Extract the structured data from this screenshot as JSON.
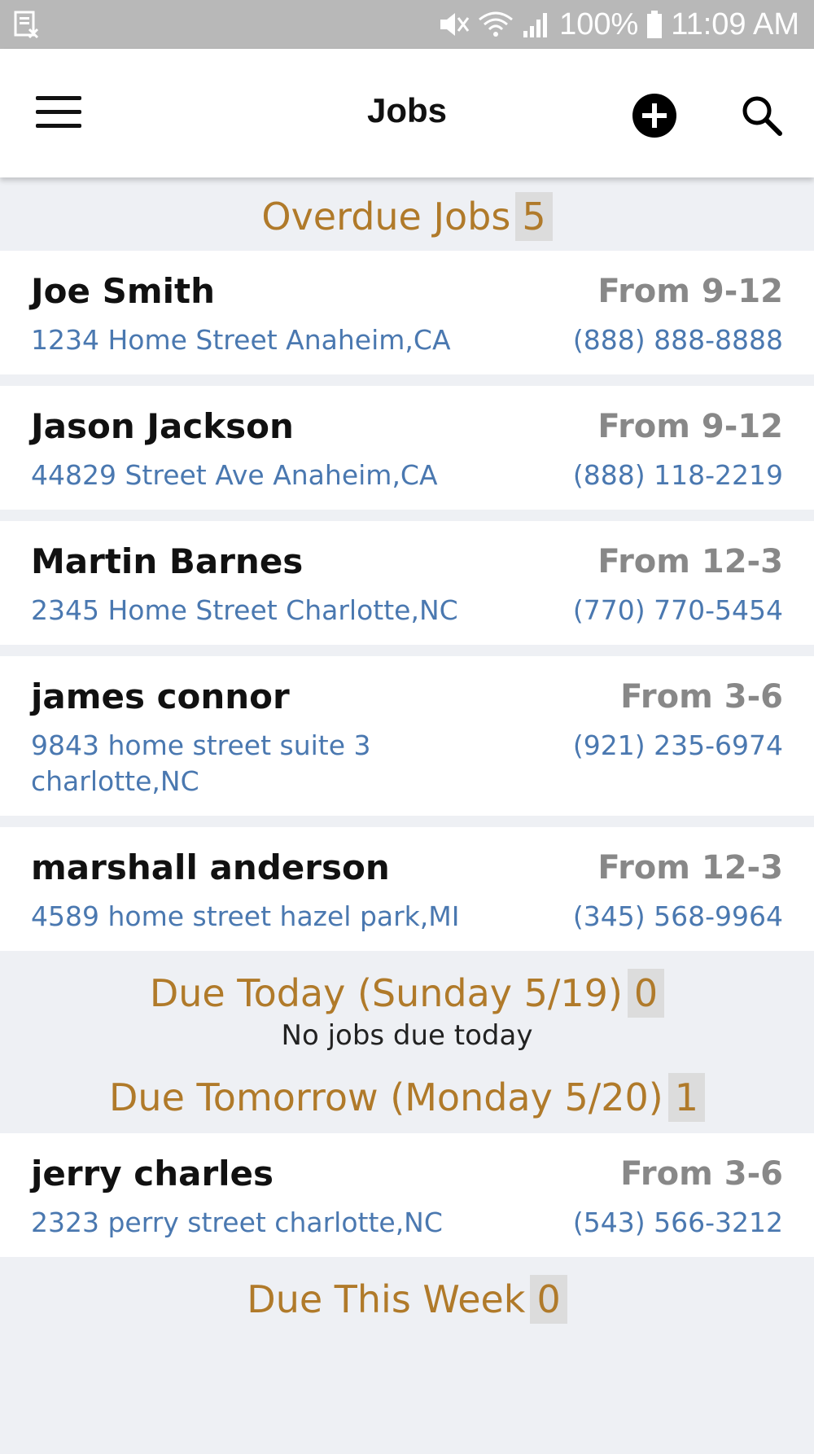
{
  "status_bar": {
    "battery": "100%",
    "time": "11:09 AM"
  },
  "appbar": {
    "title": "Jobs"
  },
  "sections": {
    "overdue": {
      "title": "Overdue Jobs",
      "count": "5",
      "jobs": [
        {
          "name": "Joe Smith",
          "time": "From 9-12",
          "address": "1234 Home Street  Anaheim,CA",
          "phone": "(888) 888-8888"
        },
        {
          "name": "Jason Jackson",
          "time": "From 9-12",
          "address": "44829 Street Ave  Anaheim,CA",
          "phone": "(888) 118-2219"
        },
        {
          "name": "Martin Barnes",
          "time": "From 12-3",
          "address": "2345 Home Street  Charlotte,NC",
          "phone": "(770) 770-5454"
        },
        {
          "name": "james connor",
          "time": "From 3-6",
          "address": "9843 home street suite 3 charlotte,NC",
          "phone": "(921) 235-6974"
        },
        {
          "name": "marshall anderson",
          "time": "From 12-3",
          "address": "4589 home street  hazel park,MI",
          "phone": "(345) 568-9964"
        }
      ]
    },
    "today": {
      "title": "Due Today (Sunday 5/19)",
      "count": "0",
      "empty_text": "No jobs due today"
    },
    "tomorrow": {
      "title": "Due Tomorrow (Monday 5/20)",
      "count": "1",
      "jobs": [
        {
          "name": "jerry charles",
          "time": "From 3-6",
          "address": "2323 perry street  charlotte,NC",
          "phone": "(543) 566-3212"
        }
      ]
    },
    "week": {
      "title": "Due This Week",
      "count": "0"
    }
  },
  "icons": {
    "menu": "hamburger-menu-icon",
    "add": "add-circle-icon",
    "search": "search-icon"
  },
  "colors": {
    "section_title": "#b07a2a",
    "link": "#4a78b0",
    "time": "#888888"
  }
}
